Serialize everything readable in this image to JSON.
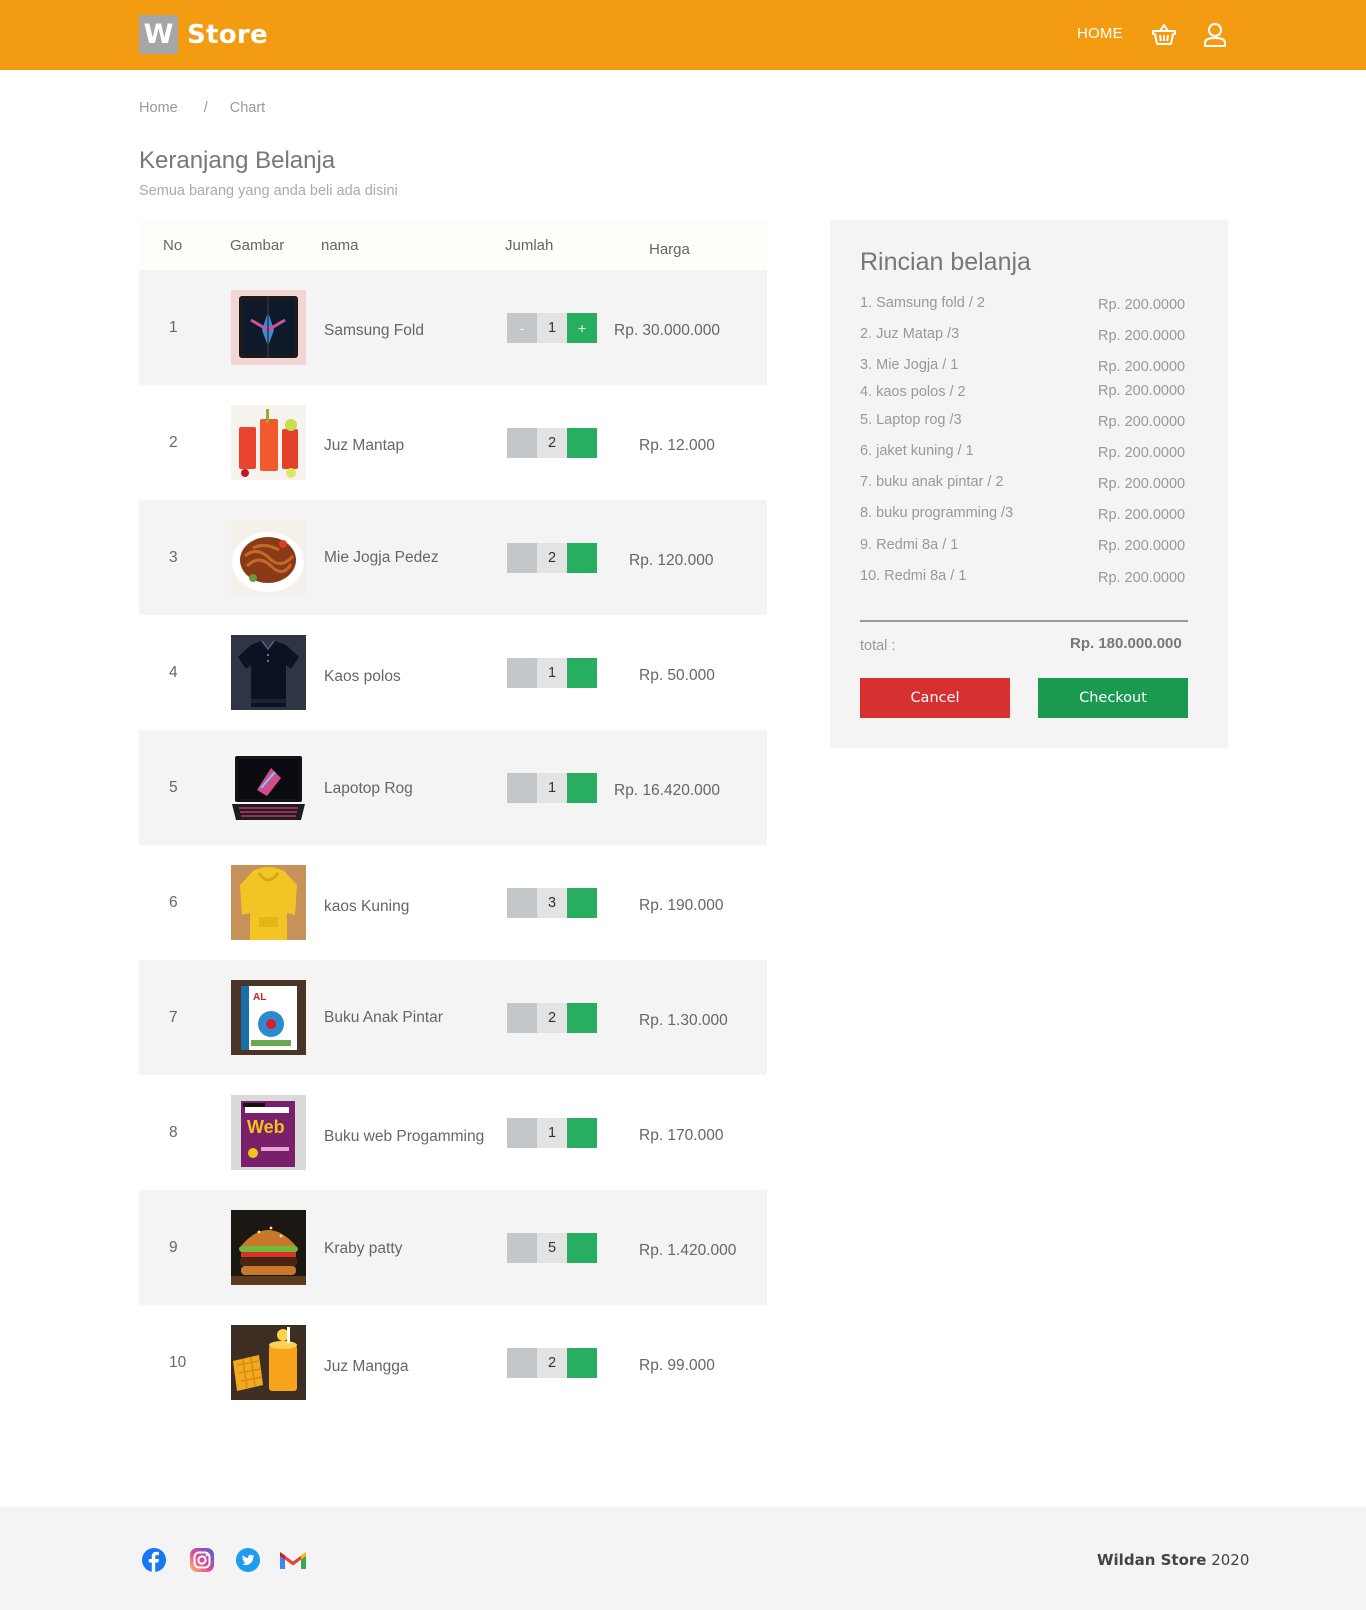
{
  "brand": {
    "logo_letter": "W",
    "name": "Store",
    "color": "#f39c12"
  },
  "nav": {
    "home": "HOME"
  },
  "breadcrumb": {
    "home": "Home",
    "separator": "/",
    "current": "Chart"
  },
  "page": {
    "title": "Keranjang Belanja",
    "subtitle": "Semua barang yang anda beli ada disini"
  },
  "table": {
    "headers": {
      "no": "No",
      "image": "Gambar",
      "name": "nama",
      "qty": "Jumlah",
      "price": "Harga"
    },
    "rows": [
      {
        "no": "1",
        "name": "Samsung Fold",
        "qty": "1",
        "price": "Rp. 30.000.000",
        "minus": "-",
        "plus": "+"
      },
      {
        "no": "2",
        "name": "Juz Mantap",
        "qty": "2",
        "price": "Rp. 12.000",
        "minus": "",
        "plus": ""
      },
      {
        "no": "3",
        "name": "Mie Jogja Pedez",
        "qty": "2",
        "price": "Rp. 120.000",
        "minus": "",
        "plus": ""
      },
      {
        "no": "4",
        "name": "Kaos polos",
        "qty": "1",
        "price": "Rp. 50.000",
        "minus": "",
        "plus": ""
      },
      {
        "no": "5",
        "name": "Lapotop Rog",
        "qty": "1",
        "price": "Rp. 16.420.000",
        "minus": "",
        "plus": ""
      },
      {
        "no": "6",
        "name": "kaos Kuning",
        "qty": "3",
        "price": "Rp. 190.000",
        "minus": "",
        "plus": ""
      },
      {
        "no": "7",
        "name": "Buku Anak Pintar",
        "qty": "2",
        "price": "Rp. 1.30.000",
        "minus": "",
        "plus": ""
      },
      {
        "no": "8",
        "name": "Buku web Progamming",
        "qty": "1",
        "price": "Rp. 170.000",
        "minus": "",
        "plus": ""
      },
      {
        "no": "9",
        "name": "Kraby patty",
        "qty": "5",
        "price": "Rp. 1.420.000",
        "minus": "",
        "plus": ""
      },
      {
        "no": "10",
        "name": "Juz Mangga",
        "qty": "2",
        "price": "Rp. 99.000",
        "minus": "",
        "plus": ""
      }
    ],
    "row_images": [
      "phone",
      "juice",
      "noodles",
      "shirt",
      "laptop",
      "hoodie",
      "book",
      "webbook",
      "burger",
      "mango"
    ]
  },
  "summary": {
    "title": "Rincian belanja",
    "items": [
      {
        "label": "1. Samsung fold / 2",
        "price": "Rp. 200.0000"
      },
      {
        "label": "2. Juz Matap /3",
        "price": "Rp. 200.0000"
      },
      {
        "label": "3. Mie Jogja / 1",
        "price": "Rp. 200.0000"
      },
      {
        "label": "4. kaos polos / 2",
        "price": "Rp. 200.0000"
      },
      {
        "label": "5. Laptop rog /3",
        "price": "Rp. 200.0000"
      },
      {
        "label": "6. jaket kuning / 1",
        "price": "Rp. 200.0000"
      },
      {
        "label": "7. buku anak pintar / 2",
        "price": "Rp. 200.0000"
      },
      {
        "label": "8. buku programming /3",
        "price": "Rp. 200.0000"
      },
      {
        "label": "9. Redmi 8a / 1",
        "price": "Rp. 200.0000"
      },
      {
        "label": "10. Redmi 8a / 1",
        "price": "Rp. 200.0000"
      }
    ],
    "total_label": "total :",
    "total_value": "Rp. 180.000.000",
    "cancel": "Cancel",
    "checkout": "Checkout",
    "cancel_color": "#d63031",
    "checkout_color": "#1a9a50"
  },
  "footer": {
    "social_icons": [
      "facebook-icon",
      "instagram-icon",
      "twitter-icon",
      "gmail-icon"
    ],
    "brand_bold": "Wildan Store",
    "year": " 2020"
  }
}
